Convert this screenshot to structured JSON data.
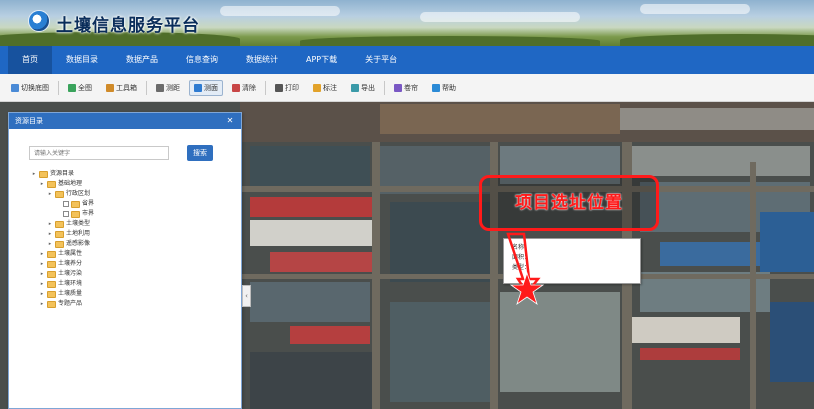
{
  "banner": {
    "title": "土壤信息服务平台"
  },
  "nav": {
    "items": [
      {
        "label": "首页",
        "active": true
      },
      {
        "label": "数据目录",
        "active": false
      },
      {
        "label": "数据产品",
        "active": false
      },
      {
        "label": "信息查询",
        "active": false
      },
      {
        "label": "数据统计",
        "active": false
      },
      {
        "label": "APP下载",
        "active": false
      },
      {
        "label": "关于平台",
        "active": false
      }
    ]
  },
  "toolbar": {
    "items": [
      {
        "label": "切换底图",
        "icon": "layers-icon"
      },
      {
        "label": "全图",
        "icon": "globe-icon"
      },
      {
        "label": "工具箱",
        "icon": "toolbox-icon"
      },
      {
        "label": "测距",
        "icon": "ruler-icon"
      },
      {
        "label": "测面",
        "icon": "area-icon",
        "selected": true
      },
      {
        "label": "清除",
        "icon": "eraser-icon"
      },
      {
        "label": "打印",
        "icon": "print-icon"
      },
      {
        "label": "标注",
        "icon": "pin-icon"
      },
      {
        "label": "导出",
        "icon": "export-icon"
      },
      {
        "label": "卷帘",
        "icon": "swipe-icon"
      },
      {
        "label": "帮助",
        "icon": "help-icon"
      }
    ]
  },
  "panel": {
    "title": "资源目录",
    "search_placeholder": "请输入关键字",
    "search_button": "搜索",
    "tree": [
      {
        "label": "资源目录",
        "level": 0,
        "type": "folder"
      },
      {
        "label": "基础地理",
        "level": 1,
        "type": "folder"
      },
      {
        "label": "行政区划",
        "level": 2,
        "type": "folder"
      },
      {
        "label": "省界",
        "level": 3,
        "type": "layer"
      },
      {
        "label": "市界",
        "level": 3,
        "type": "layer"
      },
      {
        "label": "土壤类型",
        "level": 2,
        "type": "folder"
      },
      {
        "label": "土地利用",
        "level": 2,
        "type": "folder"
      },
      {
        "label": "遥感影像",
        "level": 2,
        "type": "folder"
      },
      {
        "label": "土壤属性",
        "level": 1,
        "type": "folder"
      },
      {
        "label": "土壤养分",
        "level": 1,
        "type": "folder"
      },
      {
        "label": "土壤污染",
        "level": 1,
        "type": "folder"
      },
      {
        "label": "土壤环境",
        "level": 1,
        "type": "folder"
      },
      {
        "label": "土壤质量",
        "level": 1,
        "type": "folder"
      },
      {
        "label": "专题产品",
        "level": 1,
        "type": "folder"
      }
    ]
  },
  "popup": {
    "lines": [
      "名称：",
      "面积：",
      "类型："
    ]
  },
  "annotation": {
    "text": "项目选址位置",
    "color": "#ff1a1a",
    "marker": "star-icon"
  },
  "colors": {
    "nav": "#1f67c4",
    "panel_header": "#2f6fbf",
    "annotation": "#ff1a1a"
  }
}
